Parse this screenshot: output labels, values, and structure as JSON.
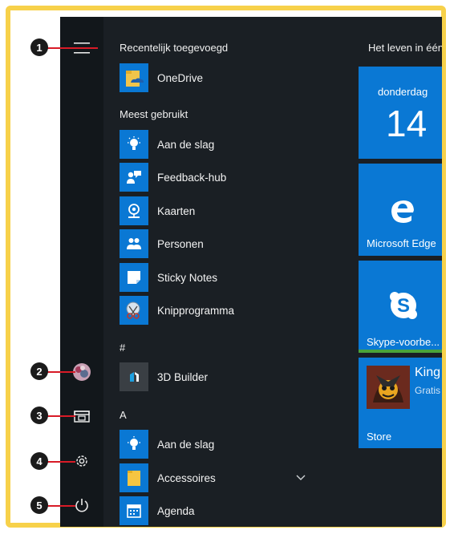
{
  "sections": {
    "recent": "Recentelijk toegevoegd",
    "most_used": "Meest gebruikt",
    "hash": "#",
    "a": "A"
  },
  "recent_apps": [
    {
      "label": "OneDrive",
      "icon": "onedrive-icon"
    }
  ],
  "most_used_apps": [
    {
      "label": "Aan de slag",
      "icon": "lightbulb-icon"
    },
    {
      "label": "Feedback-hub",
      "icon": "feedback-icon"
    },
    {
      "label": "Kaarten",
      "icon": "maps-icon"
    },
    {
      "label": "Personen",
      "icon": "people-icon"
    },
    {
      "label": "Sticky Notes",
      "icon": "sticky-notes-icon"
    },
    {
      "label": "Knipprogramma",
      "icon": "snipping-tool-icon"
    }
  ],
  "hash_apps": [
    {
      "label": "3D Builder",
      "icon": "3d-builder-icon"
    }
  ],
  "a_apps": [
    {
      "label": "Aan de slag",
      "icon": "lightbulb-icon"
    },
    {
      "label": "Accessoires",
      "icon": "folder-icon",
      "expand": "chevron-down-icon"
    },
    {
      "label": "Agenda",
      "icon": "calendar-icon"
    }
  ],
  "tiles": {
    "header": "Het leven in één",
    "calendar": {
      "day": "donderdag",
      "date": "14"
    },
    "edge": {
      "label": "Microsoft Edge"
    },
    "skype": {
      "label": "Skype-voorbe..."
    },
    "store": {
      "label": "Store",
      "app": "King",
      "sub": "Gratis"
    }
  },
  "callouts": [
    "1",
    "2",
    "3",
    "4",
    "5"
  ],
  "rail_icons": [
    "hamburger-menu-icon",
    "user-avatar",
    "file-explorer-icon",
    "settings-gear-icon",
    "power-icon"
  ],
  "colors": {
    "accent": "#0a78d4",
    "frame": "#f7d14a",
    "callout_line": "#d81b27",
    "panel": "#1a1f24"
  }
}
